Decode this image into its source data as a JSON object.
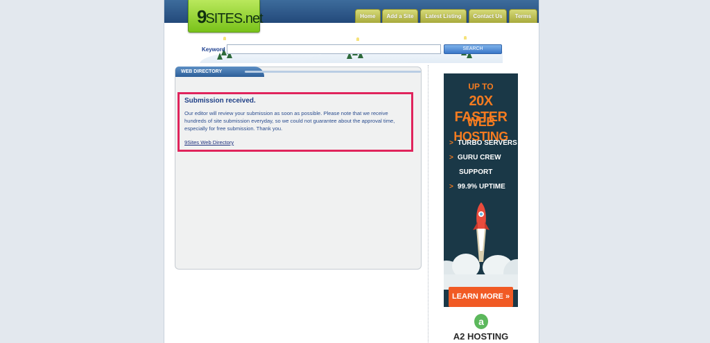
{
  "site": {
    "logo_main": "9",
    "logo_rest": "SITES.net"
  },
  "nav": {
    "items": [
      {
        "label": "Home"
      },
      {
        "label": "Add a Site"
      },
      {
        "label": "Latest Listing"
      },
      {
        "label": "Contact Us"
      },
      {
        "label": "Terms"
      }
    ]
  },
  "search": {
    "label": "Keyword :",
    "value": "",
    "placeholder": "",
    "button_label": "SEARCH"
  },
  "panel": {
    "tab_label": "WEB DIRECTORY",
    "notice_title": "Submission received.",
    "notice_body": "Our editor will review your submission as soon as possible. Please note that we receive hundreds of site submission everyday, so we could not guarantee about the approval time, especially for free submission. Thank you.",
    "notice_link": "9Sites Web Directory"
  },
  "ad": {
    "headline_1": "UP TO",
    "headline_2": "20X FASTER",
    "headline_3": "WEB HOSTING",
    "features": [
      {
        "line1": "TURBO SERVERS",
        "line2": ""
      },
      {
        "line1": "GURU CREW",
        "line2": "SUPPORT"
      },
      {
        "line1": "99.9% UPTIME",
        "line2": ""
      }
    ],
    "cta_label": "LEARN MORE »",
    "logo_letter": "a",
    "brand": "A2 HOSTING",
    "colors": {
      "background": "#1a3847",
      "accent": "#f47b20",
      "cta": "#f15a24"
    }
  },
  "colors": {
    "header": "#2d5a8a",
    "logo_green": "#8bcf2a",
    "nav_tab": "#c3c75a",
    "highlight_border": "#e0245c",
    "text_blue": "#1f3f86"
  }
}
